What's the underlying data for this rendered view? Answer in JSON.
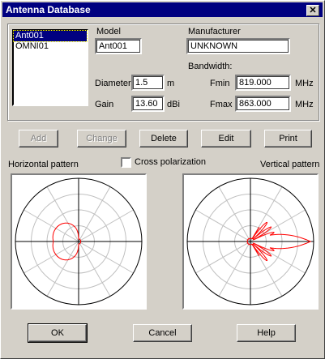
{
  "window": {
    "title": "Antenna Database",
    "close_glyph": "✕"
  },
  "antenna_list": {
    "items": [
      "Ant001",
      "OMNI01"
    ],
    "selected_index": 0
  },
  "model": {
    "label": "Model",
    "value": "Ant001"
  },
  "manufacturer": {
    "label": "Manufacturer",
    "value": "UNKNOWN"
  },
  "diameter": {
    "label": "Diameter",
    "value": "1.5",
    "unit": "m"
  },
  "gain": {
    "label": "Gain",
    "value": "13.60",
    "unit": "dBi"
  },
  "bandwidth": {
    "label": "Bandwidth:",
    "fmin_label": "Fmin",
    "fmin_value": "819.000",
    "fmin_unit": "MHz",
    "fmax_label": "Fmax",
    "fmax_value": "863.000",
    "fmax_unit": "MHz"
  },
  "actions": {
    "add": {
      "label": "Add",
      "enabled": false
    },
    "change": {
      "label": "Change",
      "enabled": false
    },
    "delete": {
      "label": "Delete",
      "enabled": true
    },
    "edit": {
      "label": "Edit",
      "enabled": true
    },
    "print": {
      "label": "Print",
      "enabled": true
    }
  },
  "patterns": {
    "horizontal_label": "Horizontal pattern",
    "vertical_label": "Vertical pattern",
    "cross_polarization_label": "Cross polarization",
    "cross_polarization_checked": false,
    "pattern_color": "#ff0000",
    "grid_color": "#c0c0c0",
    "axis_color": "#000000"
  },
  "dialog_buttons": {
    "ok": "OK",
    "cancel": "Cancel",
    "help": "Help"
  }
}
